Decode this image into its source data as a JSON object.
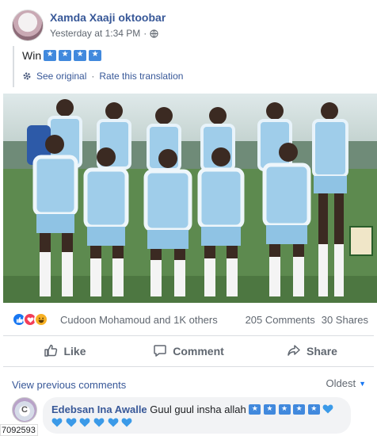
{
  "post": {
    "author": "Xamda Xaaji oktoobar",
    "timestamp": "Yesterday at 1:34 PM",
    "meta_dot": "·",
    "text": "Win",
    "text_flags_count": 4,
    "translation": {
      "see_original": "See original",
      "separator": "·",
      "rate": "Rate this translation"
    }
  },
  "reactions": {
    "types": [
      "like",
      "love",
      "haha"
    ],
    "names": "Cudoon Mohamoud and 1K others",
    "comments": "205 Comments",
    "shares": "30 Shares"
  },
  "actions": {
    "like": "Like",
    "comment": "Comment",
    "share": "Share"
  },
  "comments": {
    "view_previous": "View previous comments",
    "sort": "Oldest",
    "items": [
      {
        "author": "Edebsan Ina Awalle",
        "text": "Guul guul insha allah",
        "flags_count": 5,
        "hearts_count": 7,
        "avatar_letter": "C"
      }
    ]
  },
  "footer_id": "7092593",
  "colors": {
    "link": "#385898",
    "accent": "#1877f2",
    "muted": "#606770",
    "jersey_blue": "#9fcdea"
  }
}
